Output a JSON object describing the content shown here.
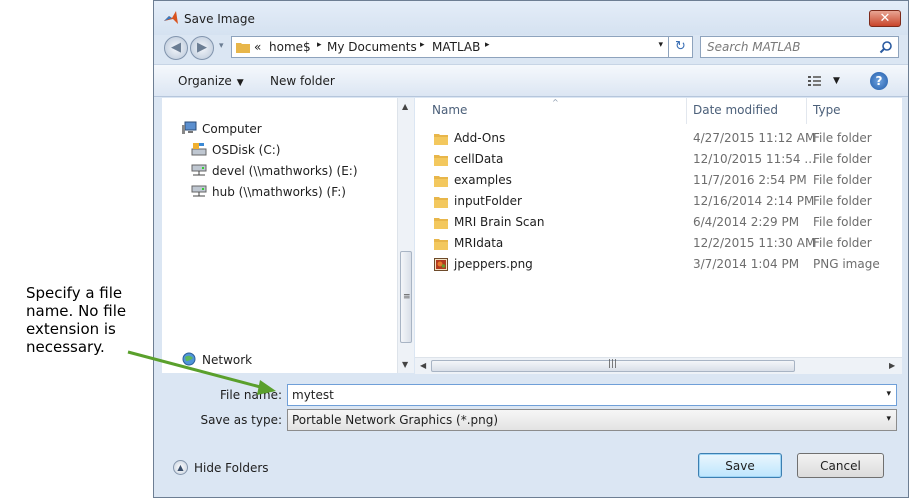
{
  "window": {
    "title": "Save Image",
    "close_glyph": "✕"
  },
  "address": {
    "history_glyph": "▾",
    "prefix": "«",
    "crumbs": [
      "home$",
      "My Documents",
      "MATLAB"
    ],
    "separator": "▸",
    "dropdown_glyph": "▾",
    "refresh_glyph": "↻"
  },
  "search": {
    "placeholder": "Search MATLAB"
  },
  "toolbar": {
    "organize": "Organize",
    "organize_arrow": "▼",
    "new_folder": "New folder",
    "views_arrow": "▼",
    "help": "?"
  },
  "nav": {
    "items": [
      {
        "label": "Computer",
        "icon": "computer-icon"
      },
      {
        "label": "OSDisk (C:)",
        "icon": "disk-icon"
      },
      {
        "label": "devel (\\\\mathworks) (E:)",
        "icon": "network-drive-icon"
      },
      {
        "label": "hub (\\\\mathworks) (F:)",
        "icon": "network-drive-icon"
      },
      {
        "label": "Network",
        "icon": "network-icon"
      }
    ]
  },
  "columns": {
    "name": "Name",
    "date": "Date modified",
    "type": "Type",
    "sort_glyph": "^"
  },
  "files": [
    {
      "name": "Add-Ons",
      "date": "4/27/2015 11:12 AM",
      "type": "File folder",
      "icon": "folder-icon"
    },
    {
      "name": "cellData",
      "date": "12/10/2015 11:54 ...",
      "type": "File folder",
      "icon": "folder-icon"
    },
    {
      "name": "examples",
      "date": "11/7/2016 2:54 PM",
      "type": "File folder",
      "icon": "folder-icon"
    },
    {
      "name": "inputFolder",
      "date": "12/16/2014 2:14 PM",
      "type": "File folder",
      "icon": "folder-icon"
    },
    {
      "name": "MRI Brain Scan",
      "date": "6/4/2014 2:29 PM",
      "type": "File folder",
      "icon": "folder-icon"
    },
    {
      "name": "MRIdata",
      "date": "12/2/2015 11:30 AM",
      "type": "File folder",
      "icon": "folder-icon"
    },
    {
      "name": "jpeppers.png",
      "date": "3/7/2014 1:04 PM",
      "type": "PNG image",
      "icon": "png-file-icon"
    }
  ],
  "form": {
    "filename_label": "File name:",
    "filename_value": "mytest",
    "savetype_label": "Save as type:",
    "savetype_value": "Portable Network Graphics (*.png)",
    "dropdown_glyph": "▾"
  },
  "footer": {
    "hide_folders": "Hide Folders",
    "save": "Save",
    "cancel": "Cancel"
  },
  "annotation": {
    "lines": [
      "Specify a file",
      "name. No file",
      "extension is",
      "necessary."
    ]
  },
  "colors": {
    "window_bg": "#dbe6f3",
    "arrow": "#5aa02c",
    "close_red": "#c9452a",
    "folder": "#e8b64a"
  }
}
